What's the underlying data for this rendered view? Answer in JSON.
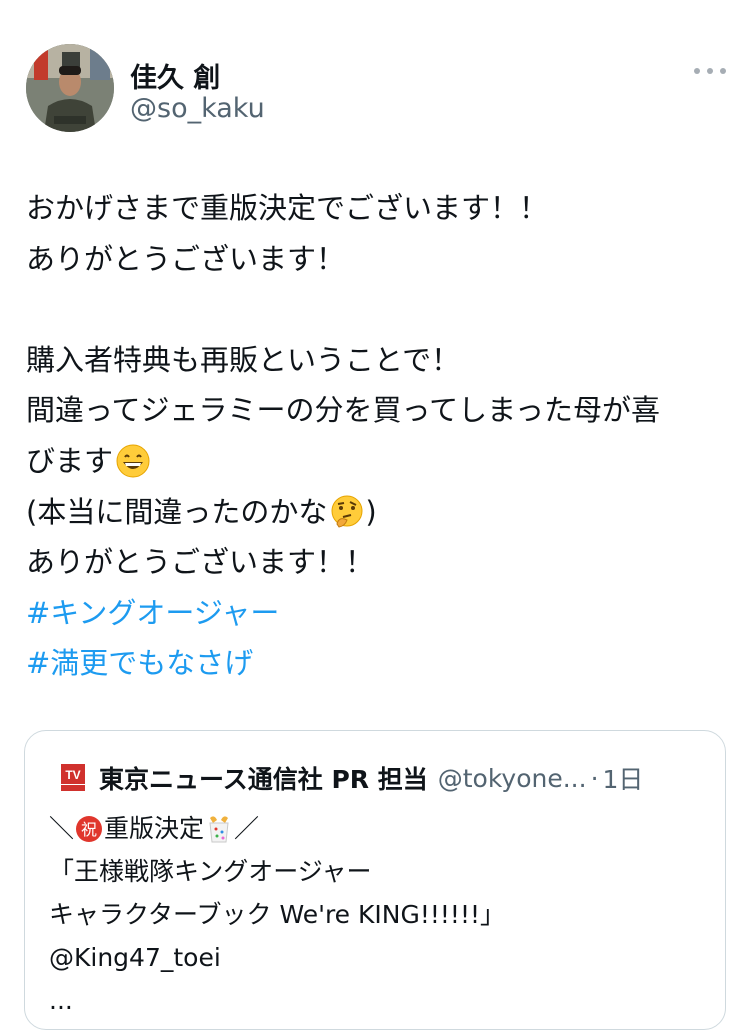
{
  "author": {
    "display_name": "佳久 創",
    "handle": "@so_kaku"
  },
  "tweet": {
    "line1": "おかげさまで重版決定でございます！！",
    "line2": "ありがとうございます！",
    "line3": "購入者特典も再販ということで！",
    "line4": "間違ってジェラミーの分を買ってしまった母が喜",
    "line5": "びます",
    "line6_before": "(本当に間違ったのかな",
    "line6_after": ")",
    "line7": "ありがとうございます！！",
    "hashtag1": "#キングオージャー",
    "hashtag2": "#満更でもなさげ"
  },
  "quote": {
    "name": "東京ニュース通信社 PR 担当",
    "handle": "@tokyone...",
    "separator": "·",
    "time": "1日",
    "line1_a": "＼",
    "line1_b": "重版決定",
    "line1_c": "／",
    "line2": "「王様戦隊キングオージャー",
    "line3": "キャラクターブック We're KING!!!!!!」",
    "line4": "@King47_toei",
    "line5": "..."
  },
  "icons": {
    "more": "more-horizontal-icon",
    "grin": "grinning-face-emoji",
    "thinking": "thinking-face-emoji",
    "celebrate": "celebration-emoji",
    "party": "party-popper-emoji"
  },
  "colors": {
    "hashtag": "#1d9bf0",
    "secondary_text": "#536471",
    "card_border": "#cfd9de"
  }
}
